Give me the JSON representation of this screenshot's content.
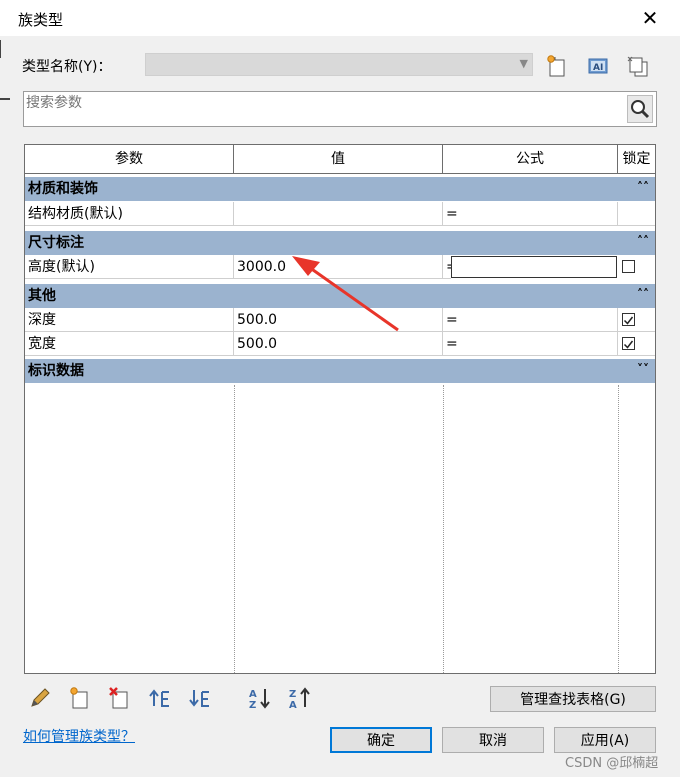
{
  "window": {
    "title": "族类型",
    "close_glyph": "✕"
  },
  "type_name": {
    "label": "类型名称(Y)：",
    "value": ""
  },
  "search": {
    "placeholder": "搜索参数"
  },
  "table": {
    "headers": [
      "参数",
      "值",
      "公式",
      "锁定"
    ],
    "groups": [
      {
        "name": "材质和装饰",
        "chevron": "˄˄",
        "rows": [
          {
            "param": "结构材质(默认)",
            "value": "",
            "formula": "=",
            "locked": null
          }
        ]
      },
      {
        "name": "尺寸标注",
        "chevron": "˄˄",
        "rows": [
          {
            "param": "高度(默认)",
            "value": "3000.0",
            "formula": "=",
            "locked": false
          }
        ]
      },
      {
        "name": "其他",
        "chevron": "˄˄",
        "rows": [
          {
            "param": "深度",
            "value": "500.0",
            "formula": "=",
            "locked": true
          },
          {
            "param": "宽度",
            "value": "500.0",
            "formula": "=",
            "locked": true
          }
        ]
      },
      {
        "name": "标识数据",
        "chevron": "˅˅",
        "rows": []
      }
    ]
  },
  "buttons": {
    "manage_lookup": "管理查找表格(G)",
    "ok": "确定",
    "cancel": "取消",
    "apply": "应用(A)"
  },
  "help_link": "如何管理族类型？",
  "watermark": "CSDN @邱楠超",
  "colors": {
    "group_band": "#9bb3cf",
    "link": "#0066cc",
    "arrow": "#e8352a"
  }
}
